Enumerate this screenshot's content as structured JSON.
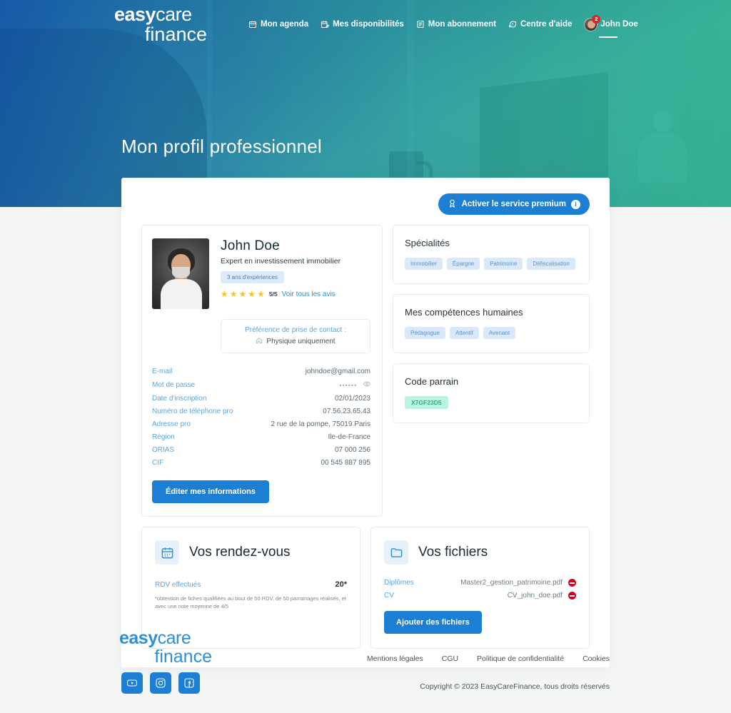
{
  "nav": {
    "logo": {
      "line1_bold": "easy",
      "line1_light": "care",
      "line2": "finance"
    },
    "items": [
      {
        "label": "Mon agenda",
        "icon": "calendar-icon"
      },
      {
        "label": "Mes disponibilités",
        "icon": "calendar-edit-icon"
      },
      {
        "label": "Mon abonnement",
        "icon": "card-icon"
      },
      {
        "label": "Centre d'aide",
        "icon": "help-chat-icon"
      }
    ],
    "user": {
      "name": "John Doe",
      "notifications": "2"
    }
  },
  "hero": {
    "title": "Mon profil professionnel"
  },
  "panel": {
    "premium_button": {
      "label": "Activer le service premium",
      "info": "i"
    }
  },
  "profile": {
    "name": "John Doe",
    "role": "Expert en investissement immobilier",
    "experience_chip": "3 ans d'expériences",
    "rating_stars": 5,
    "rating_value": "5/5",
    "reviews_link": "Voir tous les avis",
    "preference": {
      "title": "Préférence de prise de contact :",
      "value": "Physique uniquement"
    },
    "info_rows": [
      {
        "key": "E-mail",
        "value": "johndoe@gmail.com"
      },
      {
        "key": "Mot de passe",
        "value": "••••••"
      },
      {
        "key": "Date d'inscription",
        "value": "02/01/2023"
      },
      {
        "key": "Numéro de téléphone pro",
        "value": "07.56.23.65.43"
      },
      {
        "key": "Adresse pro",
        "value": "2 rue de la pompe, 75019 Paris"
      },
      {
        "key": "Région",
        "value": "Ile-de-France"
      },
      {
        "key": "ORIAS",
        "value": "07 000 256"
      },
      {
        "key": "CIF",
        "value": "00 545 887 895"
      }
    ],
    "edit_button": "Éditer mes informations"
  },
  "specialties": {
    "title": "Spécialités",
    "tags": [
      "Immobilier",
      "Épargne",
      "Patrimoine",
      "Défiscalisation"
    ]
  },
  "soft_skills": {
    "title": "Mes compétences humaines",
    "tags": [
      "Pédagogue",
      "Attentif",
      "Avenant"
    ]
  },
  "referral": {
    "title": "Code parrain",
    "code": "X7GF23D5"
  },
  "appointments": {
    "title": "Vos rendez-vous",
    "icon": "calendar-icon",
    "row_key": "RDV effectués",
    "row_value": "20*",
    "note": "*obtention de fiches qualifiées au bout de 50 RDV, de 50 parrainages réalisés, et avec une note moyenne de 4/5"
  },
  "files": {
    "title": "Vos fichiers",
    "icon": "folder-icon",
    "items": [
      {
        "key": "Diplômes",
        "value": "Master2_gestion_patrimoine.pdf"
      },
      {
        "key": "CV",
        "value": "CV_john_doe.pdf"
      }
    ],
    "add_button": "Ajouter des fichiers"
  },
  "footer": {
    "logo": {
      "line1_bold": "easy",
      "line1_light": "care",
      "line2": "finance"
    },
    "socials": [
      "youtube-icon",
      "instagram-icon",
      "facebook-icon"
    ],
    "links": [
      "Mentions légales",
      "CGU",
      "Politique de confidentialité",
      "Cookies"
    ],
    "copyright": "Copyright ©  2023 EasyCareFinance, tous droits réservés"
  },
  "colors": {
    "primary_blue": "#1c7fd4",
    "link_blue": "#5da3dd",
    "tag_blue_bg": "#d9e9fa",
    "tag_green_bg": "#b9f4e0",
    "star_yellow": "#fcc419",
    "danger_red": "#d0021b",
    "page_bg": "#f4f6f6"
  }
}
